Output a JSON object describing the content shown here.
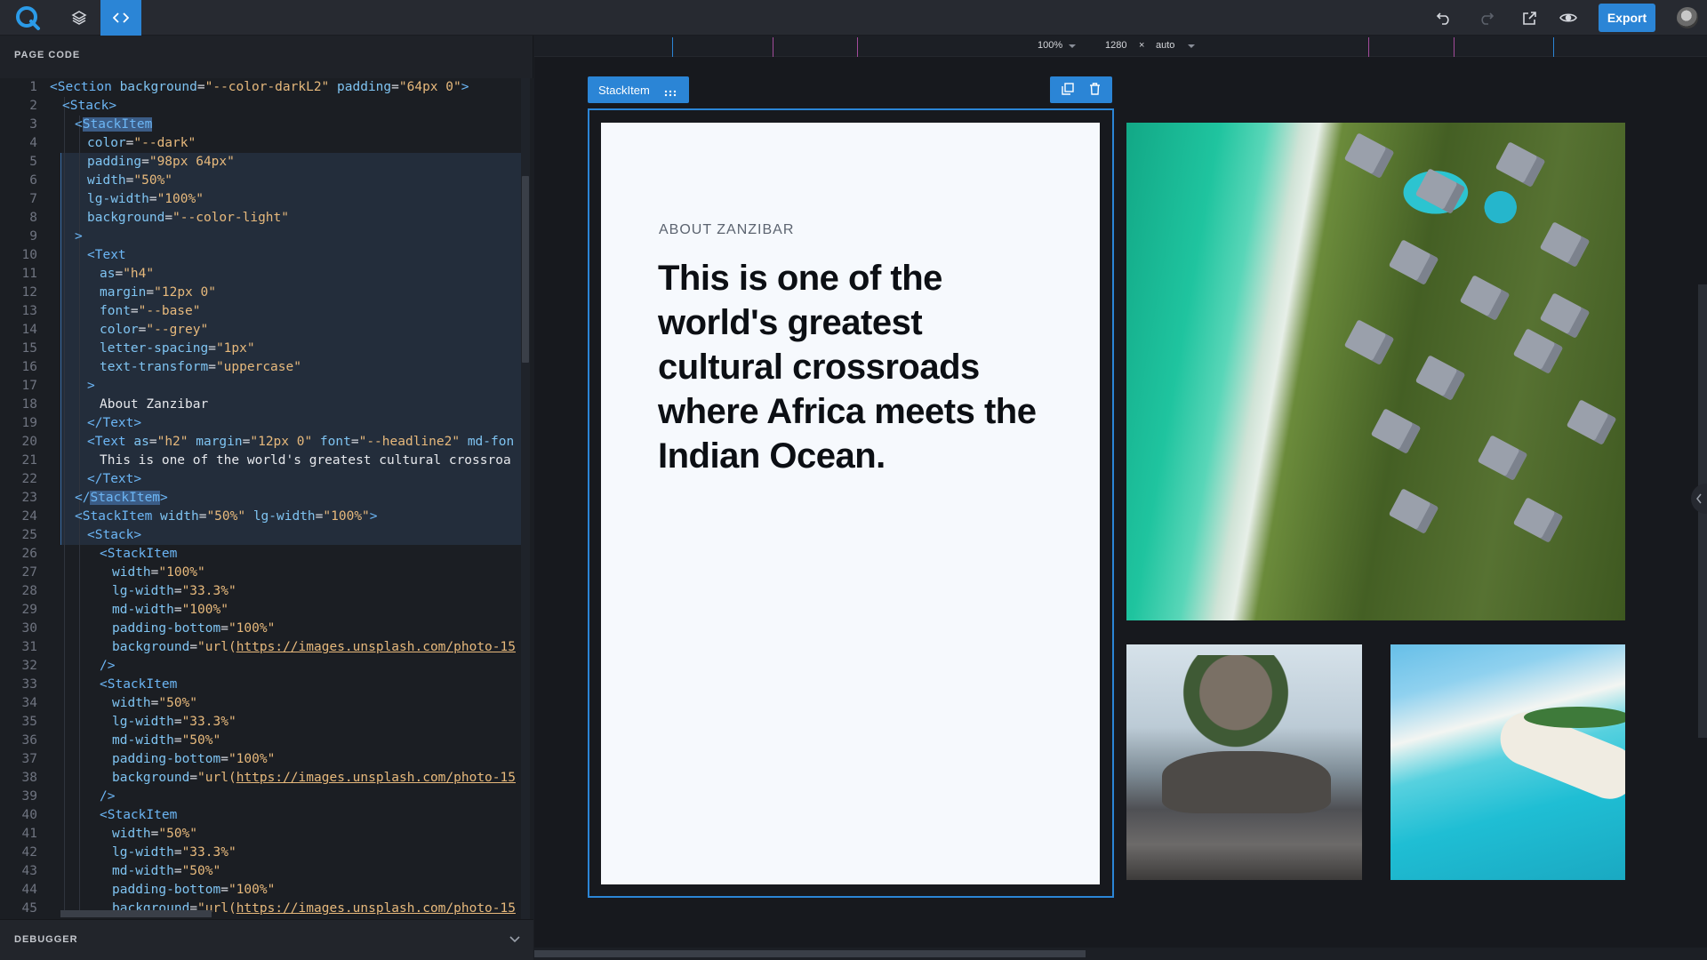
{
  "toolbar": {
    "export_label": "Export",
    "left_icons": [
      "logo-icon",
      "layers-icon",
      "code-icon"
    ],
    "right_icons": [
      "undo-icon",
      "redo-icon",
      "external-link-icon",
      "eye-icon"
    ]
  },
  "left_panel": {
    "title": "PAGE CODE",
    "debugger_title": "DEBUGGER"
  },
  "code_lines": [
    {
      "n": "1"
    },
    {
      "n": "2"
    },
    {
      "n": "3"
    },
    {
      "n": "4"
    },
    {
      "n": "5"
    },
    {
      "n": "6"
    },
    {
      "n": "7"
    },
    {
      "n": "8"
    },
    {
      "n": "9"
    },
    {
      "n": "10"
    },
    {
      "n": "11"
    },
    {
      "n": "12"
    },
    {
      "n": "13"
    },
    {
      "n": "14"
    },
    {
      "n": "15"
    },
    {
      "n": "16"
    },
    {
      "n": "17"
    },
    {
      "n": "18"
    },
    {
      "n": "19"
    },
    {
      "n": "20"
    },
    {
      "n": "21"
    },
    {
      "n": "22"
    },
    {
      "n": "23"
    },
    {
      "n": "24"
    },
    {
      "n": "25"
    },
    {
      "n": "26"
    },
    {
      "n": "27"
    },
    {
      "n": "28"
    },
    {
      "n": "29"
    },
    {
      "n": "30"
    },
    {
      "n": "31"
    },
    {
      "n": "32"
    },
    {
      "n": "33"
    },
    {
      "n": "34"
    },
    {
      "n": "35"
    },
    {
      "n": "36"
    },
    {
      "n": "37"
    },
    {
      "n": "38"
    },
    {
      "n": "39"
    },
    {
      "n": "40"
    },
    {
      "n": "41"
    },
    {
      "n": "42"
    },
    {
      "n": "43"
    },
    {
      "n": "44"
    },
    {
      "n": "45"
    }
  ],
  "code": {
    "l1": {
      "tag": "<Section",
      "a1": " background",
      "v1": "\"--color-darkL2\"",
      "a2": " padding",
      "v2": "\"64px 0\"",
      "end": ">"
    },
    "l2": "<Stack>",
    "l3": "StackItem",
    "l4": {
      "a": "color",
      "v": "\"--dark\""
    },
    "l5": {
      "a": "padding",
      "v": "\"98px 64px\""
    },
    "l6": {
      "a": "width",
      "v": "\"50%\""
    },
    "l7": {
      "a": "lg-width",
      "v": "\"100%\""
    },
    "l8": {
      "a": "background",
      "v": "\"--color-light\""
    },
    "l9": ">",
    "l10": "<Text",
    "l11": {
      "a": "as",
      "v": "\"h4\""
    },
    "l12": {
      "a": "margin",
      "v": "\"12px 0\""
    },
    "l13": {
      "a": "font",
      "v": "\"--base\""
    },
    "l14": {
      "a": "color",
      "v": "\"--grey\""
    },
    "l15": {
      "a": "letter-spacing",
      "v": "\"1px\""
    },
    "l16": {
      "a": "text-transform",
      "v": "\"uppercase\""
    },
    "l17": ">",
    "l18": "About Zanzibar",
    "l19": "</Text>",
    "l20": {
      "tag": "<Text",
      "a1": " as",
      "v1": "\"h2\"",
      "a2": " margin",
      "v2": "\"12px 0\"",
      "a3": " font",
      "v3": "\"--headline2\"",
      "a4": " md-fon"
    },
    "l21": "This is one of the world's greatest cultural crossroa",
    "l22": "</Text>",
    "l23": {
      "open": "</",
      "tag": "StackItem",
      "end": ">"
    },
    "l24": {
      "tag": "<StackItem",
      "a1": " width",
      "v1": "\"50%\"",
      "a2": " lg-width",
      "v2": "\"100%\"",
      "end": ">"
    },
    "l25": "<Stack>",
    "l26": "<StackItem",
    "l27": {
      "a": "width",
      "v": "\"100%\""
    },
    "l28": {
      "a": "lg-width",
      "v": "\"33.3%\""
    },
    "l29": {
      "a": "md-width",
      "v": "\"100%\""
    },
    "l30": {
      "a": "padding-bottom",
      "v": "\"100%\""
    },
    "l31": {
      "a": "background",
      "pre": "\"url(",
      "url": "https://images.unsplash.com/photo-15"
    },
    "l32": "/>",
    "l33": "<StackItem",
    "l34": {
      "a": "width",
      "v": "\"50%\""
    },
    "l35": {
      "a": "lg-width",
      "v": "\"33.3%\""
    },
    "l36": {
      "a": "md-width",
      "v": "\"50%\""
    },
    "l37": {
      "a": "padding-bottom",
      "v": "\"100%\""
    },
    "l38": {
      "a": "background",
      "pre": "\"url(",
      "url": "https://images.unsplash.com/photo-15"
    },
    "l39": "/>",
    "l40": "<StackItem",
    "l41": {
      "a": "width",
      "v": "\"50%\""
    },
    "l42": {
      "a": "lg-width",
      "v": "\"33.3%\""
    },
    "l43": {
      "a": "md-width",
      "v": "\"50%\""
    },
    "l44": {
      "a": "padding-bottom",
      "v": "\"100%\""
    },
    "l45": {
      "a": "background",
      "pre": "\"url(",
      "url": "https://images.unsplash.com/photo-15"
    }
  },
  "canvas": {
    "zoom": "100%",
    "width": "1280",
    "times": "×",
    "height": "auto",
    "selection_label": "StackItem",
    "eyebrow": "About Zanzibar",
    "headline": "This is one of the world's greatest cultural crossroads where Africa meets the Indian Ocean."
  },
  "colors": {
    "accent": "#2b85d6",
    "card_background": "#f6f9fd",
    "editor_background": "#1b1e23"
  }
}
